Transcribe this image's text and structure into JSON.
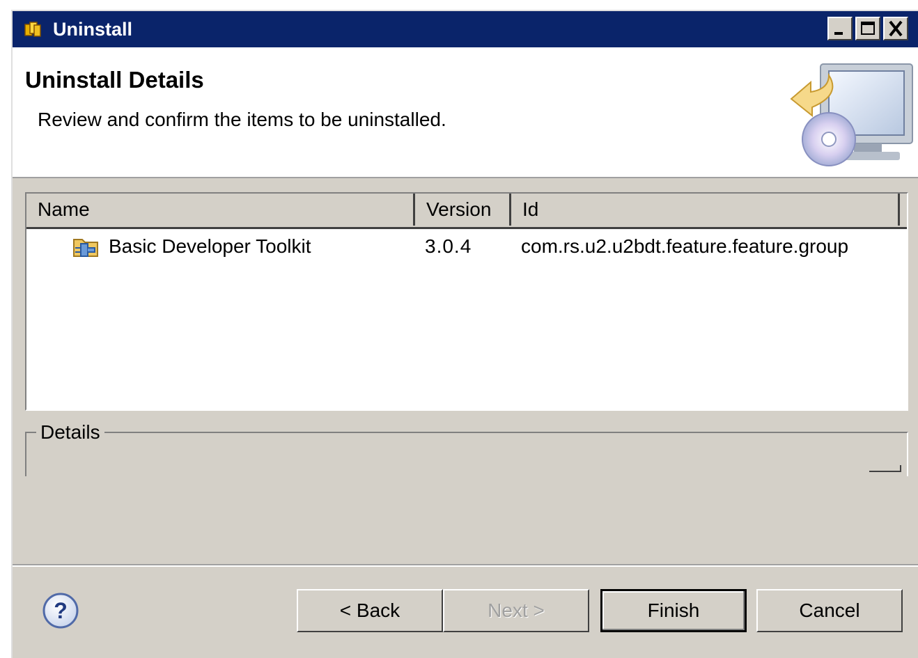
{
  "window": {
    "title": "Uninstall",
    "title_icon": "installer-icon",
    "controls": [
      "minimize-icon",
      "maximize-icon",
      "close-icon"
    ]
  },
  "header": {
    "title": "Uninstall Details",
    "description": "Review and confirm the items to be uninstalled.",
    "banner": "uninstall-computer-cd-icon"
  },
  "table": {
    "columns": [
      "Name",
      "Version",
      "Id"
    ],
    "rows": [
      {
        "icon": "feature-icon",
        "name": "Basic Developer Toolkit",
        "version": "3.0.4",
        "id": "com.rs.u2.u2bdt.feature.feature.group"
      }
    ]
  },
  "details": {
    "label": "Details",
    "text": ""
  },
  "footer": {
    "help_icon": "help-icon",
    "back_label": "< Back",
    "next_label": "Next >",
    "finish_label": "Finish",
    "cancel_label": "Cancel",
    "next_enabled": false,
    "default_button": "Finish"
  },
  "colors": {
    "titlebar": "#0a246a",
    "dialog_bg": "#d4d0c8",
    "header_bg": "#ffffff",
    "disabled_text": "#a0a0a0"
  }
}
